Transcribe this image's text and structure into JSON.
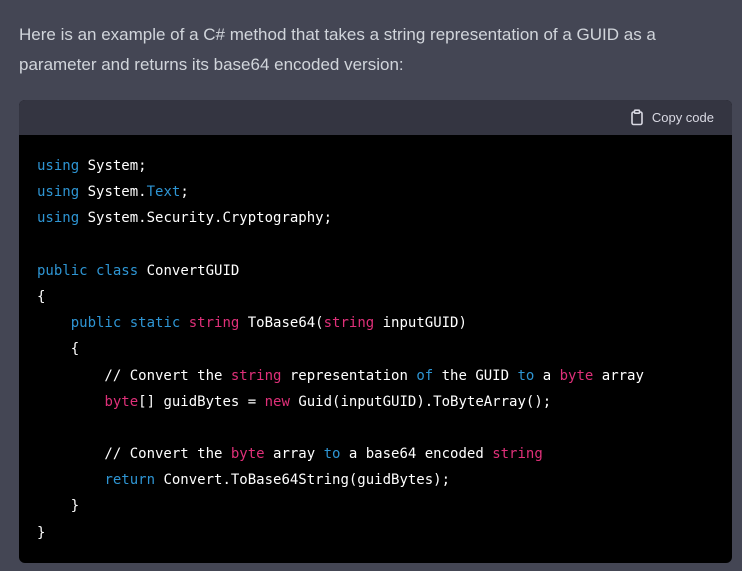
{
  "intro_text": "Here is an example of a C# method that takes a string representation of a GUID as a parameter and returns its base64 encoded version:",
  "code_block": {
    "copy_label": "Copy code",
    "copy_icon": "clipboard-icon",
    "colors": {
      "keyword": "#2e95d3",
      "type": "#df3079",
      "text": "#ffffff",
      "header_bg": "#343541",
      "code_bg": "#000000",
      "page_bg": "#444654"
    },
    "lines": [
      [
        [
          "keyword",
          "using"
        ],
        [
          "plain",
          " System;"
        ]
      ],
      [
        [
          "keyword",
          "using"
        ],
        [
          "plain",
          " System."
        ],
        [
          "keyword",
          "Text"
        ],
        [
          "plain",
          ";"
        ]
      ],
      [
        [
          "keyword",
          "using"
        ],
        [
          "plain",
          " System.Security.Cryptography;"
        ]
      ],
      [],
      [
        [
          "keyword",
          "public"
        ],
        [
          "plain",
          " "
        ],
        [
          "keyword",
          "class"
        ],
        [
          "plain",
          " ConvertGUID"
        ]
      ],
      [
        [
          "plain",
          "{"
        ]
      ],
      [
        [
          "plain",
          "    "
        ],
        [
          "keyword",
          "public"
        ],
        [
          "plain",
          " "
        ],
        [
          "keyword",
          "static"
        ],
        [
          "plain",
          " "
        ],
        [
          "type",
          "string"
        ],
        [
          "plain",
          " ToBase64("
        ],
        [
          "type",
          "string"
        ],
        [
          "plain",
          " inputGUID)"
        ]
      ],
      [
        [
          "plain",
          "    {"
        ]
      ],
      [
        [
          "plain",
          "        // Convert the "
        ],
        [
          "type",
          "string"
        ],
        [
          "plain",
          " representation "
        ],
        [
          "keyword",
          "of"
        ],
        [
          "plain",
          " the GUID "
        ],
        [
          "keyword",
          "to"
        ],
        [
          "plain",
          " a "
        ],
        [
          "type",
          "byte"
        ],
        [
          "plain",
          " array"
        ]
      ],
      [
        [
          "plain",
          "        "
        ],
        [
          "type",
          "byte"
        ],
        [
          "plain",
          "[] guidBytes = "
        ],
        [
          "type",
          "new"
        ],
        [
          "plain",
          " Guid(inputGUID).ToByteArray();"
        ]
      ],
      [],
      [
        [
          "plain",
          "        // Convert the "
        ],
        [
          "type",
          "byte"
        ],
        [
          "plain",
          " array "
        ],
        [
          "keyword",
          "to"
        ],
        [
          "plain",
          " a base64 encoded "
        ],
        [
          "type",
          "string"
        ]
      ],
      [
        [
          "plain",
          "        "
        ],
        [
          "keyword",
          "return"
        ],
        [
          "plain",
          " Convert.ToBase64String(guidBytes);"
        ]
      ],
      [
        [
          "plain",
          "    }"
        ]
      ],
      [
        [
          "plain",
          "}"
        ]
      ]
    ]
  }
}
